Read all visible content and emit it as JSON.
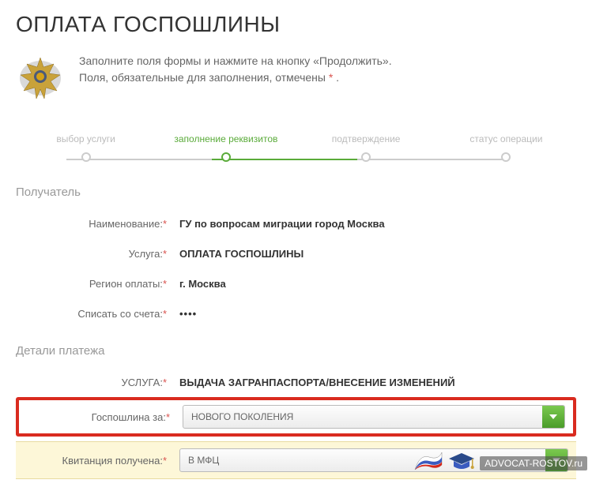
{
  "title": "ОПЛАТА ГОСПОШЛИНЫ",
  "intro": {
    "line1": "Заполните поля формы и нажмите на кнопку «Продолжить».",
    "line2_prefix": "Поля, обязательные для заполнения, отмечены ",
    "line2_suffix": " ."
  },
  "steps": {
    "s1": "выбор услуги",
    "s2": "заполнение реквизитов",
    "s3": "подтверждение",
    "s4": "статус операции"
  },
  "recipient": {
    "header": "Получатель",
    "name_label": "Наименование:",
    "name_value": "ГУ по вопросам миграции город Москва",
    "service_label": "Услуга:",
    "service_value": "ОПЛАТА ГОСПОШЛИНЫ",
    "region_label": "Регион оплаты:",
    "region_value": "г. Москва",
    "account_label": "Списать со счета:",
    "account_value": "••••"
  },
  "details": {
    "header": "Детали платежа",
    "service_label": "УСЛУГА:",
    "service_value": "ВЫДАЧА ЗАГРАНПАСПОРТА/ВНЕСЕНИЕ ИЗМЕНЕНИЙ",
    "fee_label": "Госпошлина за:",
    "fee_value": "НОВОГО ПОКОЛЕНИЯ",
    "receipt_label": "Квитанция получена:",
    "receipt_value": "В МФЦ"
  },
  "watermark": "ADVOCAT-ROSTOV.ru"
}
